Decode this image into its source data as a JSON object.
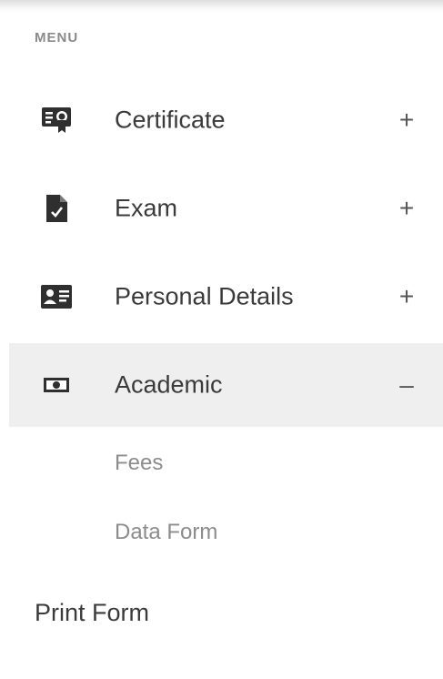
{
  "menu": {
    "caption": "MENU",
    "items": [
      {
        "label": "Certificate",
        "icon": "certificate-icon",
        "toggle": "+"
      },
      {
        "label": "Exam",
        "icon": "exam-document-icon",
        "toggle": "+"
      },
      {
        "label": "Personal Details",
        "icon": "id-card-icon",
        "toggle": "+"
      },
      {
        "label": "Academic",
        "icon": "money-bill-icon",
        "toggle": "–"
      }
    ],
    "submenu": {
      "items": [
        {
          "label": "Fees"
        },
        {
          "label": "Data Form"
        }
      ]
    },
    "print_form_label": "Print Form"
  },
  "colors": {
    "active_background": "#efefef",
    "icon": "#2f2f2f",
    "text": "#3a3a3a",
    "subtext": "#8c8c8c"
  }
}
